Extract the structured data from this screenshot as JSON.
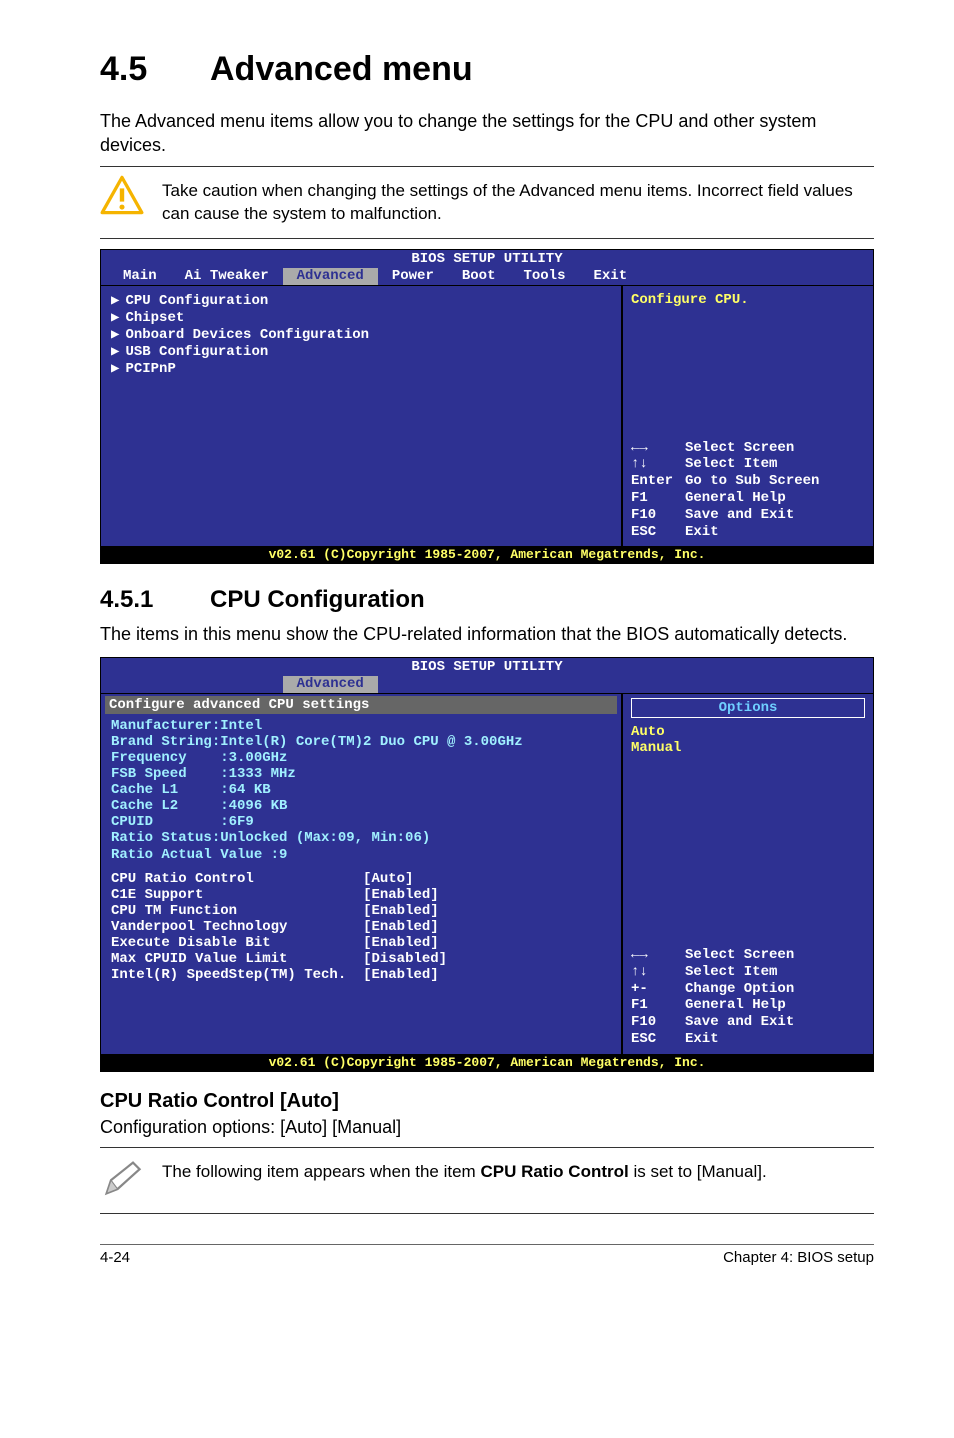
{
  "section": {
    "number": "4.5",
    "title": "Advanced menu"
  },
  "intro": "The Advanced menu items allow you to change the settings for the CPU and other system devices.",
  "caution_note": "Take caution when changing the settings of the Advanced menu items. Incorrect field values can cause the system to malfunction.",
  "bios1": {
    "title": "BIOS SETUP UTILITY",
    "tabs": [
      "Main",
      "Ai Tweaker",
      "Advanced",
      "Power",
      "Boot",
      "Tools",
      "Exit"
    ],
    "active_tab": "Advanced",
    "menu_items": [
      "CPU Configuration",
      "Chipset",
      "Onboard Devices Configuration",
      "USB Configuration",
      "PCIPnP"
    ],
    "right_hint": "Configure CPU.",
    "nav": {
      "l1": {
        "key": "←→",
        "txt": "Select Screen"
      },
      "l2": {
        "key": "↑↓",
        "txt": "Select Item"
      },
      "l3": {
        "key": "Enter",
        "txt": "Go to Sub Screen"
      },
      "l4": {
        "key": "F1",
        "txt": "General Help"
      },
      "l5": {
        "key": "F10",
        "txt": "Save and Exit"
      },
      "l6": {
        "key": "ESC",
        "txt": "Exit"
      }
    },
    "footer": "v02.61 (C)Copyright 1985-2007, American Megatrends, Inc."
  },
  "subsection": {
    "number": "4.5.1",
    "title": "CPU Configuration"
  },
  "subsection_intro": "The items in this menu show the CPU-related information that the BIOS automatically detects.",
  "bios2": {
    "title": "BIOS SETUP UTILITY",
    "active_tab": "Advanced",
    "header_line": "Configure advanced CPU settings",
    "info": {
      "l1": "Manufacturer:Intel",
      "l2": "Brand String:Intel(R) Core(TM)2 Duo CPU @ 3.00GHz",
      "l3": "Frequency    :3.00GHz",
      "l4": "FSB Speed    :1333 MHz",
      "l5": "Cache L1     :64 KB",
      "l6": "Cache L2     :4096 KB",
      "l7": "CPUID        :6F9",
      "l8": "Ratio Status:Unlocked (Max:09, Min:06)",
      "l9": "Ratio Actual Value :9"
    },
    "settings": [
      {
        "name": "CPU Ratio Control",
        "value": "[Auto]"
      },
      {
        "name": "C1E Support",
        "value": "[Enabled]"
      },
      {
        "name": "CPU TM Function",
        "value": "[Enabled]"
      },
      {
        "name": "Vanderpool Technology",
        "value": "[Enabled]"
      },
      {
        "name": "Execute Disable Bit",
        "value": "[Enabled]"
      },
      {
        "name": "Max CPUID Value Limit",
        "value": "[Disabled]"
      },
      {
        "name": "Intel(R) SpeedStep(TM) Tech.",
        "value": "[Enabled]"
      }
    ],
    "options_label": "Options",
    "options": [
      "Auto",
      "Manual"
    ],
    "nav": {
      "l1": {
        "key": "←→",
        "txt": "Select Screen"
      },
      "l2": {
        "key": "↑↓",
        "txt": "Select Item"
      },
      "l3": {
        "key": "+-",
        "txt": "Change Option"
      },
      "l4": {
        "key": "F1",
        "txt": "General Help"
      },
      "l5": {
        "key": "F10",
        "txt": "Save and Exit"
      },
      "l6": {
        "key": "ESC",
        "txt": "Exit"
      }
    },
    "footer": "v02.61 (C)Copyright 1985-2007, American Megatrends, Inc."
  },
  "item": {
    "title": "CPU Ratio Control [Auto]",
    "body": "Configuration options: [Auto] [Manual]"
  },
  "pencil_note": {
    "pre": "The following item appears when the item ",
    "bold": "CPU Ratio Control",
    "post": " is set to [Manual]."
  },
  "footer": {
    "left": "4-24",
    "right": "Chapter 4: BIOS setup"
  }
}
